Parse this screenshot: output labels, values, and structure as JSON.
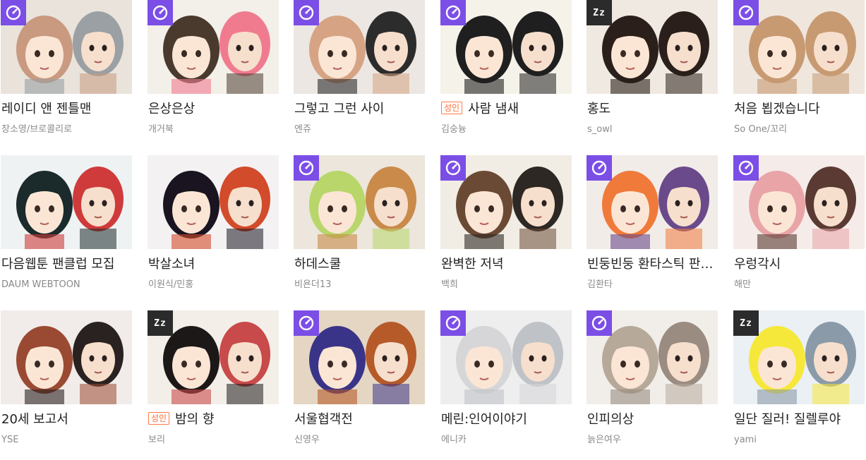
{
  "colors": {
    "timer_badge": "#7b4ee6",
    "sleep_badge": "#2b2b2b",
    "adult_tag": "#ff6a33",
    "title": "#222222",
    "author": "#8a8a8a"
  },
  "adult_label": "성인",
  "sleep_label": "Zz",
  "cards": [
    {
      "title": "레이디 앤 젠틀맨",
      "author": "장소영/브로콜리로",
      "badge": "timer-icon",
      "adult": false,
      "bg": "#e9e3dc",
      "hair1": "#c99a80",
      "hair2": "#9aa0a3"
    },
    {
      "title": "은상은상",
      "author": "개거북",
      "badge": "timer-icon",
      "adult": false,
      "bg": "#f3efe9",
      "hair1": "#4a3a2e",
      "hair2": "#f07b8f"
    },
    {
      "title": "그렇고 그런 사이",
      "author": "엔쥬",
      "badge": "timer-icon",
      "adult": false,
      "bg": "#ece7e2",
      "hair1": "#d6a484",
      "hair2": "#2c2c2c"
    },
    {
      "title": "사람 냄새",
      "author": "김숭늉",
      "badge": "timer-icon",
      "adult": true,
      "bg": "#f5f2ea",
      "hair1": "#1f1f1f",
      "hair2": "#1f1f1f"
    },
    {
      "title": "홍도",
      "author": "s_owl",
      "badge": "sleep",
      "adult": false,
      "bg": "#efe9e2",
      "hair1": "#2a1f1a",
      "hair2": "#2a1f1a"
    },
    {
      "title": "처음 뵙겠습니다",
      "author": "So One/꼬리",
      "badge": "timer-icon",
      "adult": false,
      "bg": "#efe6de",
      "hair1": "#c79a72",
      "hair2": "#c79a72"
    },
    {
      "title": "다음웹툰 팬클럽 모집",
      "author": "DAUM WEBTOON",
      "badge": "none",
      "adult": false,
      "bg": "#eef2f3",
      "hair1": "#1b2a2a",
      "hair2": "#cf3b3b"
    },
    {
      "title": "박살소녀",
      "author": "이원식/민홍",
      "badge": "none",
      "adult": false,
      "bg": "#f4f1f3",
      "hair1": "#1a1420",
      "hair2": "#d24b2a"
    },
    {
      "title": "하데스쿨",
      "author": "비욘더13",
      "badge": "timer-icon",
      "adult": false,
      "bg": "#ece6dc",
      "hair1": "#b8d66a",
      "hair2": "#c98a4a"
    },
    {
      "title": "완벽한 저녁",
      "author": "백희",
      "badge": "timer-icon",
      "adult": false,
      "bg": "#f2ede4",
      "hair1": "#6b4a35",
      "hair2": "#2e2824"
    },
    {
      "title": "빈둥빈둥 환타스틱 판타지",
      "author": "김환타",
      "badge": "timer-icon",
      "adult": false,
      "bg": "#f1ece8",
      "hair1": "#f07a3a",
      "hair2": "#6a4a8a"
    },
    {
      "title": "우렁각시",
      "author": "해만",
      "badge": "timer-icon",
      "adult": false,
      "bg": "#f5ece9",
      "hair1": "#e9a4a8",
      "hair2": "#5a3a32"
    },
    {
      "title": "20세 보고서",
      "author": "YSE",
      "badge": "none",
      "adult": false,
      "bg": "#f1ecea",
      "hair1": "#9a4a32",
      "hair2": "#2a2220"
    },
    {
      "title": "밤의 향",
      "author": "보리",
      "badge": "sleep",
      "adult": true,
      "bg": "#f3efe8",
      "hair1": "#1c1818",
      "hair2": "#c84a4a"
    },
    {
      "title": "서울협객전",
      "author": "신영우",
      "badge": "timer-icon",
      "adult": false,
      "bg": "#e4d6c3",
      "hair1": "#3a3488",
      "hair2": "#b65a2a"
    },
    {
      "title": "메린:인어이야기",
      "author": "에니카",
      "badge": "timer-icon",
      "adult": false,
      "bg": "#eeeeee",
      "hair1": "#d6d6d8",
      "hair2": "#bfc3c8"
    },
    {
      "title": "인피의상",
      "author": "늙은여우",
      "badge": "timer-icon",
      "adult": false,
      "bg": "#f1eeea",
      "hair1": "#b7a99a",
      "hair2": "#9a8c80"
    },
    {
      "title": "일단 질러! 질렐루야",
      "author": "yami",
      "badge": "sleep",
      "adult": false,
      "bg": "#eaf0f4",
      "hair1": "#f6e83a",
      "hair2": "#8a9aa8"
    }
  ]
}
